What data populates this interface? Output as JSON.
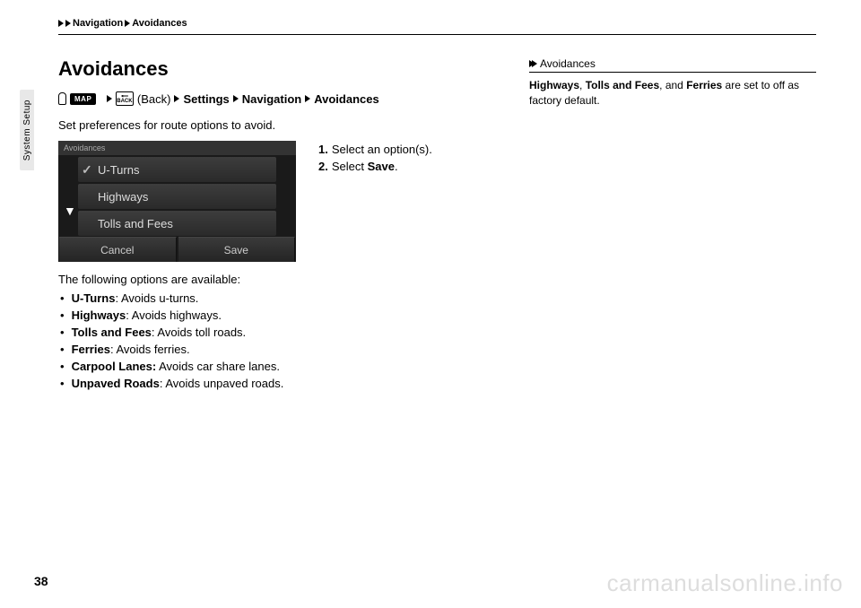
{
  "breadcrumb": {
    "seg1": "Navigation",
    "seg2": "Avoidances"
  },
  "sideTab": "System Setup",
  "title": "Avoidances",
  "navPath": {
    "mapLabel": "MAP",
    "backIconLabel": "BACK",
    "backText": "(Back)",
    "seg_settings": "Settings",
    "seg_navigation": "Navigation",
    "seg_avoidances": "Avoidances"
  },
  "intro": "Set preferences for route options to avoid.",
  "screenshot": {
    "header": "Avoidances",
    "rows": [
      "U-Turns",
      "Highways",
      "Tolls and Fees"
    ],
    "checkedIndex": 0,
    "arrow": "▼",
    "btnCancel": "Cancel",
    "btnSave": "Save"
  },
  "steps": [
    {
      "num": "1.",
      "text": "Select an option(s)."
    },
    {
      "num": "2.",
      "pre": "Select ",
      "bold": "Save",
      "post": "."
    }
  ],
  "optsIntro": "The following options are available:",
  "opts": [
    {
      "name": "U-Turns",
      "desc": ": Avoids u-turns."
    },
    {
      "name": "Highways",
      "desc": ": Avoids highways."
    },
    {
      "name": "Tolls and Fees",
      "desc": ": Avoids toll roads."
    },
    {
      "name": "Ferries",
      "desc": ": Avoids ferries."
    },
    {
      "name": "Carpool Lanes:",
      "desc": " Avoids car share lanes."
    },
    {
      "name": "Unpaved Roads",
      "desc": ": Avoids unpaved roads."
    }
  ],
  "sideNote": {
    "header": "Avoidances",
    "b1": "Highways",
    "t1": ", ",
    "b2": "Tolls and Fees",
    "t2": ", and ",
    "b3": "Ferries",
    "t3": " are set to off as factory default."
  },
  "pageNum": "38",
  "watermark": "carmanualsonline.info"
}
